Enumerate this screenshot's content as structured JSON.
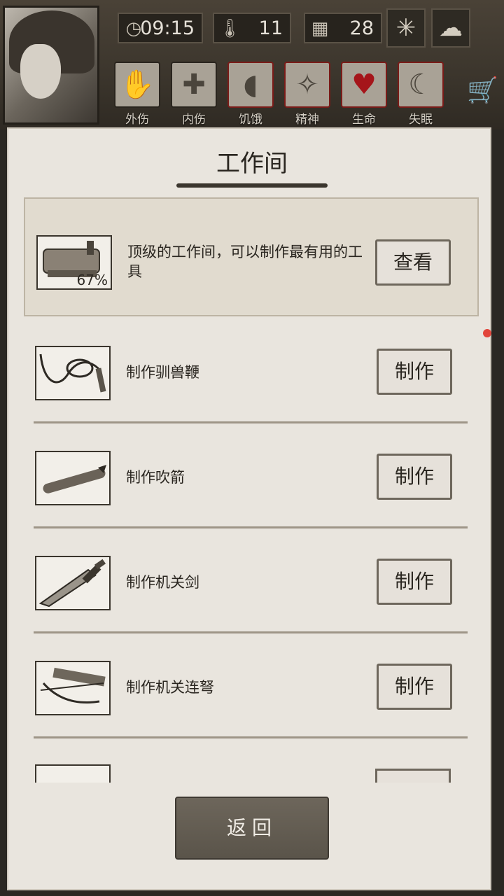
{
  "header": {
    "time": "09:15",
    "temperature": "11",
    "day": "28",
    "icons": [
      "clock-icon",
      "thermometer-icon",
      "calendar-icon",
      "leaf-icon",
      "rain-cloud-icon"
    ]
  },
  "statuses": [
    {
      "label": "外伤",
      "icon": "hand-bandage-icon"
    },
    {
      "label": "内伤",
      "icon": "cross-icon"
    },
    {
      "label": "饥饿",
      "icon": "stomach-icon"
    },
    {
      "label": "精神",
      "icon": "head-sparkle-icon"
    },
    {
      "label": "生命",
      "icon": "heart-icon"
    },
    {
      "label": "失眠",
      "icon": "moon-star-icon"
    }
  ],
  "panel": {
    "title": "工作间",
    "featured": {
      "description": "顶级的工作间，可以制作最有用的工具",
      "progress": "67%",
      "action": "查看"
    },
    "items": [
      {
        "label": "制作驯兽鞭",
        "action": "制作",
        "icon": "whip-icon"
      },
      {
        "label": "制作吹箭",
        "action": "制作",
        "icon": "blowgun-icon"
      },
      {
        "label": "制作机关剑",
        "action": "制作",
        "icon": "sword-icon"
      },
      {
        "label": "制作机关连弩",
        "action": "制作",
        "icon": "crossbow-icon"
      }
    ]
  },
  "footer": {
    "back_label": "返回"
  }
}
